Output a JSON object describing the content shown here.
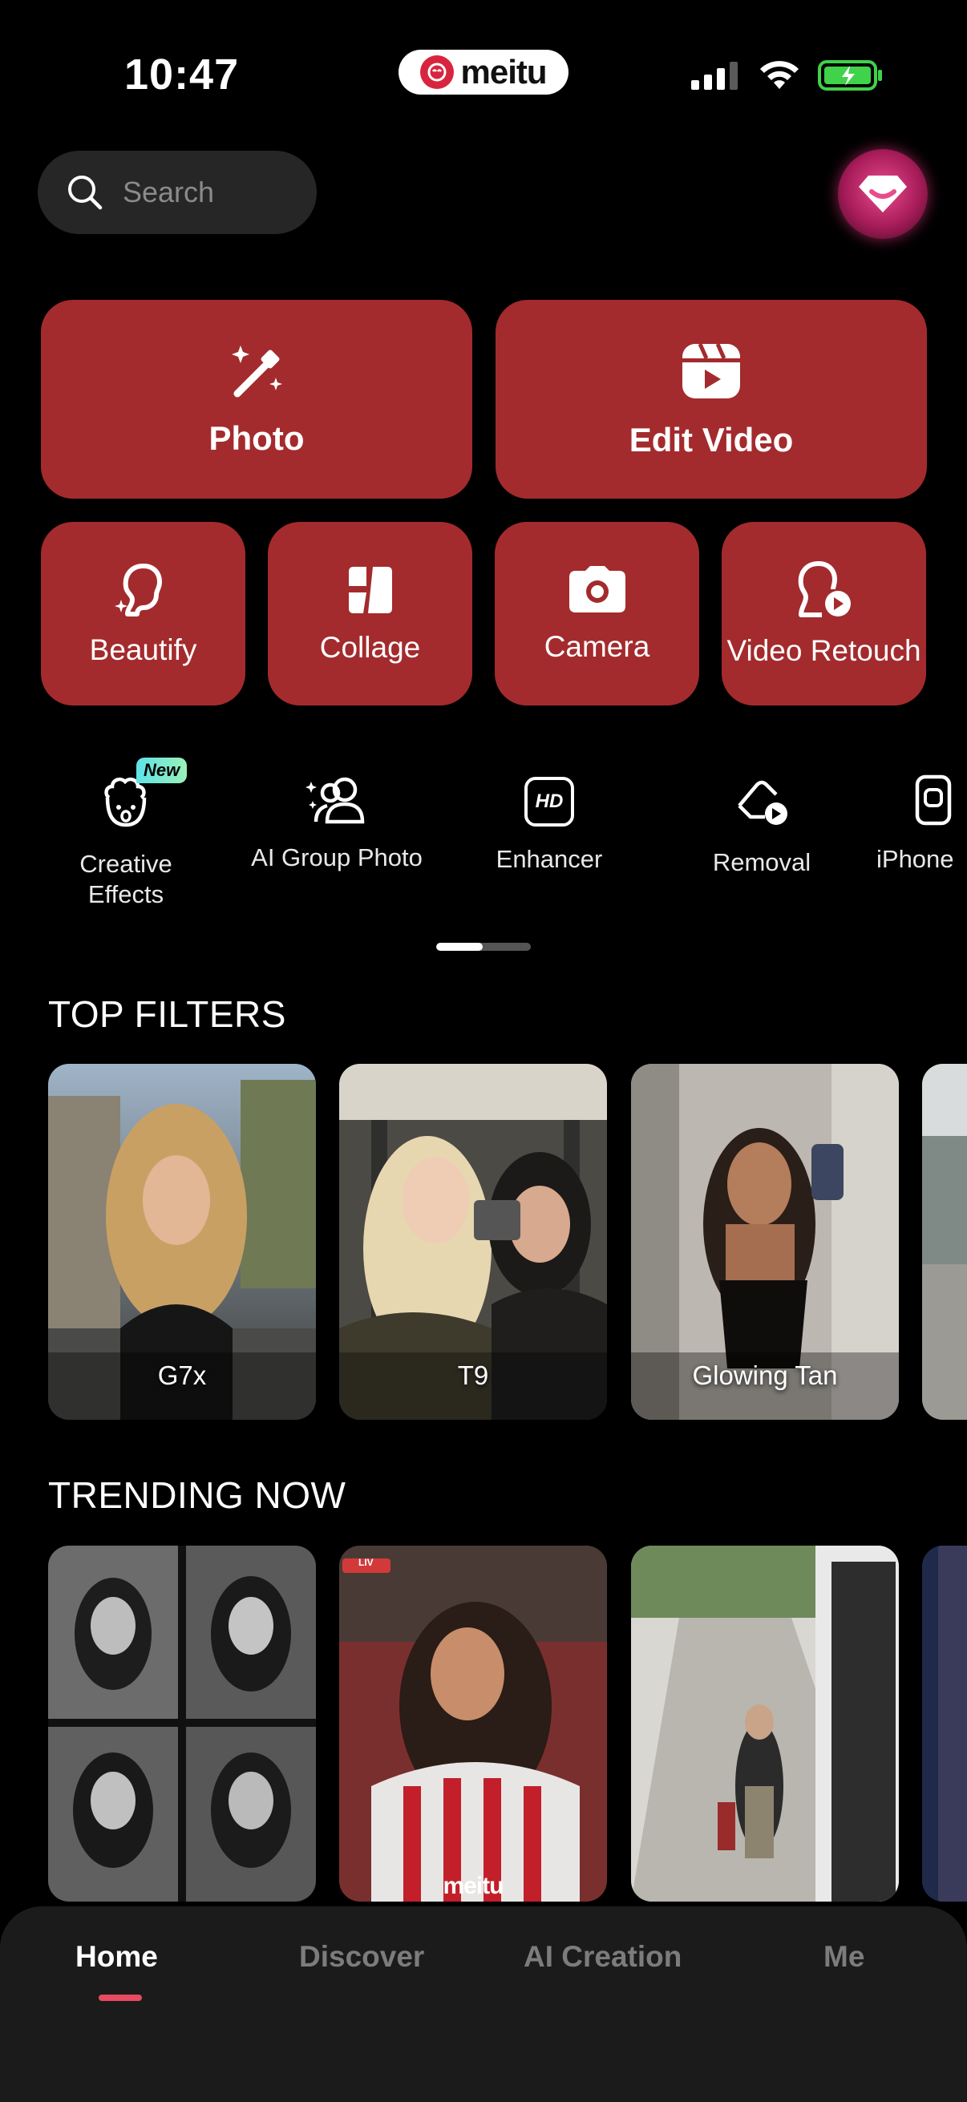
{
  "status_bar": {
    "time": "10:47",
    "brand": "meitu"
  },
  "search": {
    "placeholder": "Search"
  },
  "main_tiles": [
    {
      "label": "Photo",
      "icon": "magic-wand-icon"
    },
    {
      "label": "Edit Video",
      "icon": "video-clapper-icon"
    }
  ],
  "small_tiles": [
    {
      "label": "Beautify",
      "icon": "face-sparkle-icon"
    },
    {
      "label": "Collage",
      "icon": "collage-grid-icon"
    },
    {
      "label": "Camera",
      "icon": "camera-icon"
    },
    {
      "label": "Video Retouch",
      "icon": "face-play-icon"
    }
  ],
  "tools": [
    {
      "label": "Creative\nEffects",
      "icon": "creative-effects-icon",
      "badge": "New"
    },
    {
      "label": "AI Group Photo",
      "icon": "group-photo-icon"
    },
    {
      "label": "Enhancer",
      "icon": "hd-icon",
      "icon_text": "HD"
    },
    {
      "label": "Removal",
      "icon": "eraser-icon"
    },
    {
      "label": "iPhone",
      "icon": "iphone-icon"
    }
  ],
  "sections": {
    "top_filters": {
      "title": "TOP FILTERS",
      "cards": [
        {
          "label": "G7x"
        },
        {
          "label": "T9"
        },
        {
          "label": "Glowing Tan"
        }
      ]
    },
    "trending_now": {
      "title": "TRENDING NOW",
      "watermark": "meitu",
      "live_tag": "LIV"
    }
  },
  "bottom_nav": [
    {
      "label": "Home",
      "active": true
    },
    {
      "label": "Discover",
      "active": false
    },
    {
      "label": "AI Creation",
      "active": false
    },
    {
      "label": "Me",
      "active": false
    }
  ],
  "colors": {
    "accent": "#a32b2d",
    "background": "#000000",
    "nav_indicator": "#e84a5f"
  }
}
